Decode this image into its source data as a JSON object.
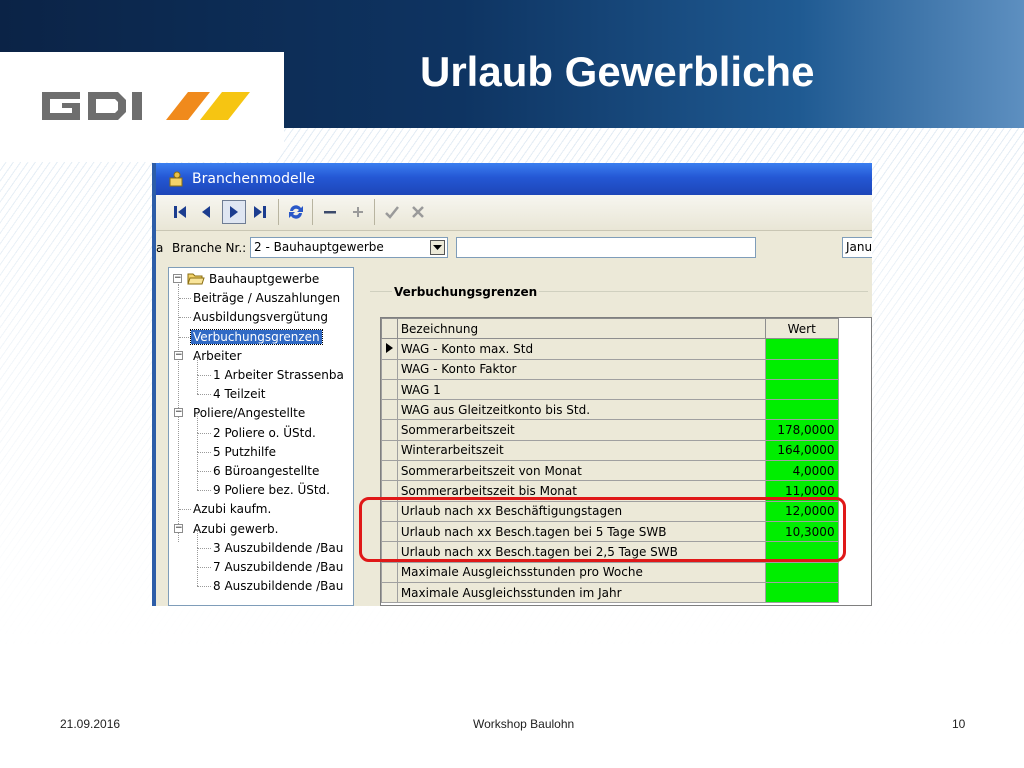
{
  "slide": {
    "title": "Urlaub Gewerbliche",
    "logo_text": "GDI",
    "logo_colors": {
      "letters": "#6e6e6e",
      "stripe_1": "#f08a1c",
      "stripe_2": "#f6c512"
    },
    "footer": {
      "date": "21.09.2016",
      "center": "Workshop Baulohn",
      "page": "10"
    }
  },
  "window": {
    "title": "Branchenmodelle",
    "toolbar_icons": [
      "first-record-icon",
      "previous-record-icon",
      "next-record-icon",
      "last-record-icon",
      "refresh-icon",
      "delete-record-icon",
      "add-record-icon",
      "confirm-icon",
      "cancel-icon"
    ],
    "branche_label": "Branche Nr.:",
    "branche_value": "2 - Bauhauptgewerbe",
    "month_value": "Janu",
    "clipped_left_char": "a"
  },
  "tree": {
    "root": "Bauhauptgewerbe",
    "items": [
      {
        "label": "Beiträge / Auszahlungen",
        "level": 1
      },
      {
        "label": "Ausbildungsvergütung",
        "level": 1
      },
      {
        "label": "Verbuchungsgrenzen",
        "level": 1,
        "selected": true
      },
      {
        "label": "Arbeiter",
        "level": 1,
        "expandable": true
      },
      {
        "label": "1 Arbeiter Strassenba",
        "level": 2
      },
      {
        "label": "4 Teilzeit",
        "level": 2
      },
      {
        "label": "Poliere/Angestellte",
        "level": 1,
        "expandable": true
      },
      {
        "label": "2 Poliere o. ÜStd.",
        "level": 2
      },
      {
        "label": "5 Putzhilfe",
        "level": 2
      },
      {
        "label": "6 Büroangestellte",
        "level": 2
      },
      {
        "label": "9 Poliere bez. ÜStd.",
        "level": 2
      },
      {
        "label": "Azubi kaufm.",
        "level": 1
      },
      {
        "label": "Azubi gewerb.",
        "level": 1,
        "expandable": true
      },
      {
        "label": "3 Auszubildende /Bau",
        "level": 2
      },
      {
        "label": "7 Auszubildende /Bau",
        "level": 2
      },
      {
        "label": "8 Auszubildende /Bau",
        "level": 2
      }
    ]
  },
  "grid": {
    "group_title": "Verbuchungsgrenzen",
    "columns": {
      "name": "Bezeichnung",
      "value": "Wert"
    },
    "rows": [
      {
        "name": "WAG - Konto max. Std",
        "value": "",
        "current": true
      },
      {
        "name": "WAG - Konto Faktor",
        "value": ""
      },
      {
        "name": "WAG 1",
        "value": ""
      },
      {
        "name": "WAG aus Gleitzeitkonto bis Std.",
        "value": ""
      },
      {
        "name": "Sommerarbeitszeit",
        "value": "178,0000"
      },
      {
        "name": "Winterarbeitszeit",
        "value": "164,0000"
      },
      {
        "name": "Sommerarbeitszeit von Monat",
        "value": "4,0000"
      },
      {
        "name": "Sommerarbeitszeit bis Monat",
        "value": "11,0000"
      },
      {
        "name": "Urlaub nach xx Beschäftigungstagen",
        "value": "12,0000"
      },
      {
        "name": "Urlaub nach xx Besch.tagen bei 5 Tage SWB",
        "value": "10,3000"
      },
      {
        "name": "Urlaub nach xx Besch.tagen bei 2,5 Tage SWB",
        "value": ""
      },
      {
        "name": "Maximale Ausgleichsstunden pro Woche",
        "value": ""
      },
      {
        "name": "Maximale Ausgleichsstunden im Jahr",
        "value": ""
      }
    ],
    "value_cell_color": "#00ee00",
    "highlight_color": "#e01818"
  }
}
